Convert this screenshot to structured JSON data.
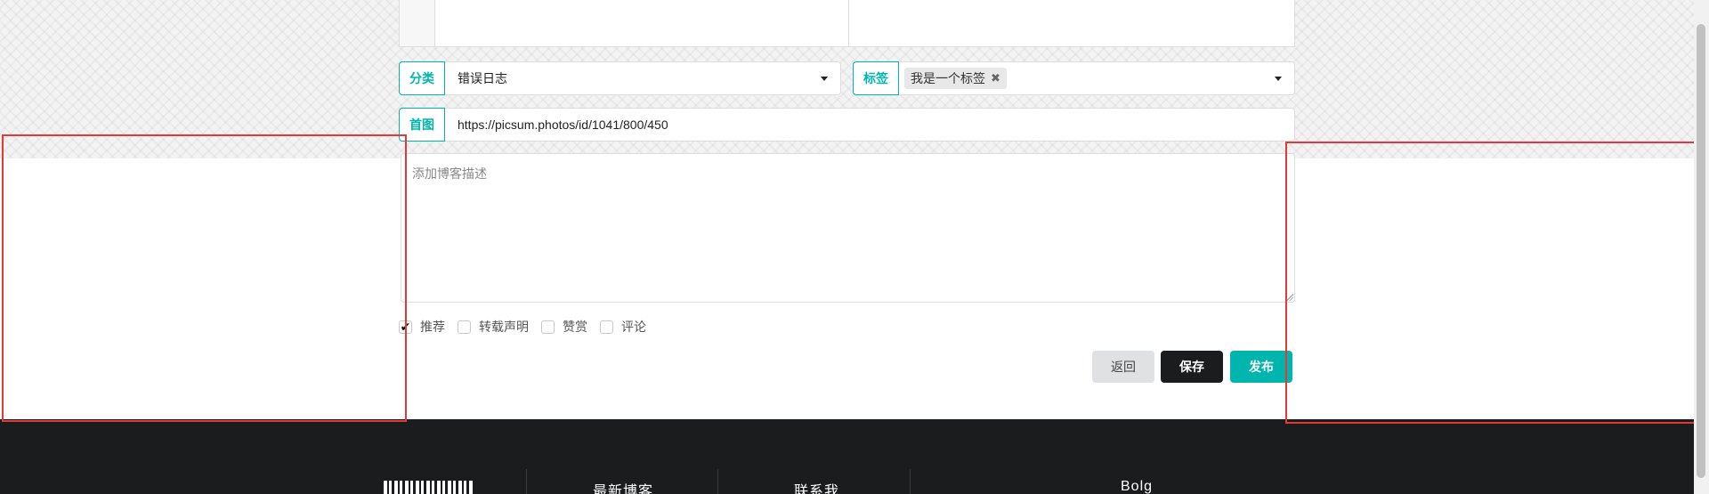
{
  "form": {
    "category": {
      "label": "分类",
      "value": "错误日志"
    },
    "tags": {
      "label": "标签",
      "chips": [
        {
          "text": "我是一个标签",
          "remove": "✖"
        }
      ]
    },
    "cover": {
      "label": "首图",
      "value": "https://picsum.photos/id/1041/800/450"
    },
    "description": {
      "placeholder": "添加博客描述"
    },
    "options": [
      {
        "label": "推荐",
        "checked": true
      },
      {
        "label": "转载声明",
        "checked": false
      },
      {
        "label": "赞赏",
        "checked": false
      },
      {
        "label": "评论",
        "checked": false
      }
    ],
    "actions": {
      "back": "返回",
      "save": "保存",
      "publish": "发布"
    }
  },
  "footer": {
    "columns": [
      {
        "title": "最新博客"
      },
      {
        "title": "联系我"
      },
      {
        "title": "Bolg"
      }
    ]
  },
  "colors": {
    "accent": "#00b5ad",
    "dark": "#1b1c1d",
    "annotation": "#e53935"
  }
}
